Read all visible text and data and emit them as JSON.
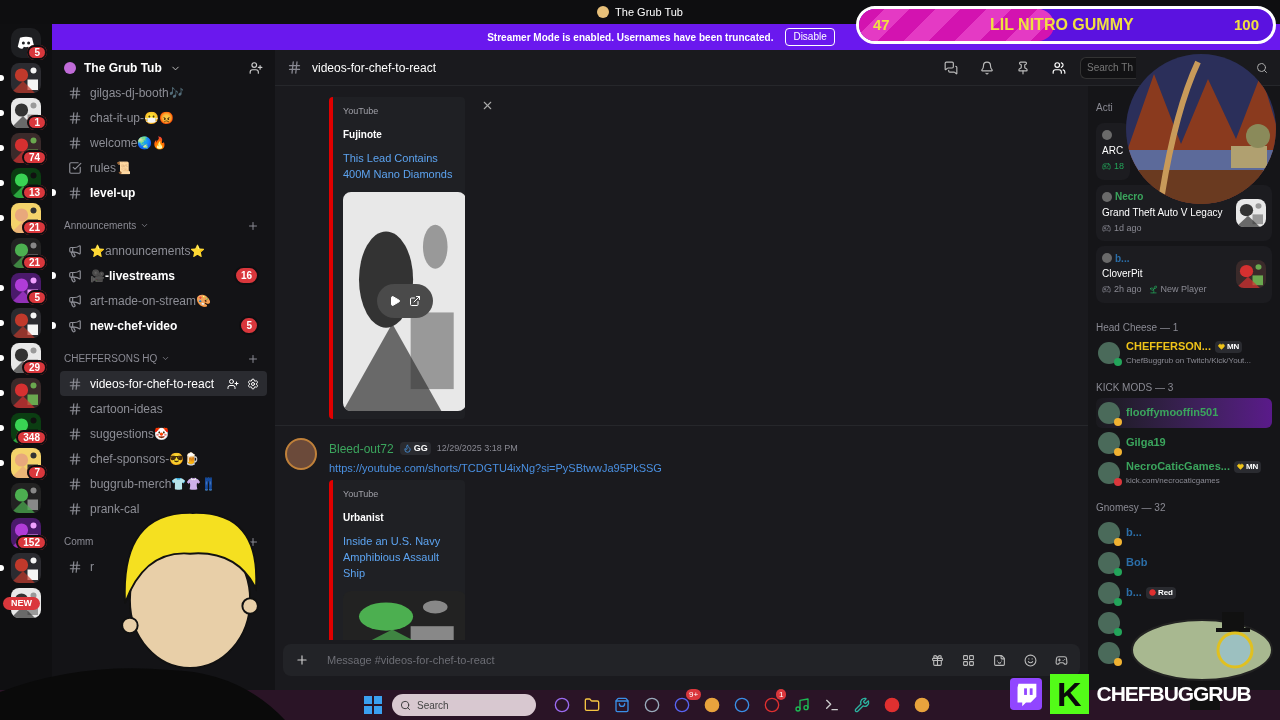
{
  "window": {
    "title": "The Grub Tub"
  },
  "goal_overlay": {
    "current": "47",
    "title": "LIL NITRO GUMMY",
    "target": "100",
    "level": 0.47
  },
  "servers": [
    {
      "kind": "home",
      "badge": "5",
      "unread": false
    },
    {
      "kind": "server",
      "unread": true
    },
    {
      "kind": "server",
      "badge": "1",
      "unread": true
    },
    {
      "kind": "server",
      "badge": "74",
      "unread": true
    },
    {
      "kind": "server",
      "badge": "13",
      "unread": true
    },
    {
      "kind": "server",
      "badge": "21",
      "unread": true
    },
    {
      "kind": "server",
      "badge": "21",
      "unread": false
    },
    {
      "kind": "server",
      "badge": "5",
      "unread": true
    },
    {
      "kind": "server",
      "unread": true
    },
    {
      "kind": "server",
      "badge": "29",
      "unread": true
    },
    {
      "kind": "server",
      "unread": true
    },
    {
      "kind": "server",
      "badge": "348",
      "unread": true
    },
    {
      "kind": "server",
      "badge": "7",
      "unread": true
    },
    {
      "kind": "server",
      "unread": false
    },
    {
      "kind": "server",
      "badge": "152",
      "unread": false
    },
    {
      "kind": "server",
      "unread": true
    },
    {
      "kind": "server",
      "badge": "NEW",
      "unread": false
    }
  ],
  "banner": {
    "text": "Streamer Mode is enabled. Usernames have been truncated.",
    "button": "Disable"
  },
  "server_header": {
    "name": "The Grub Tub"
  },
  "channel_groups": [
    {
      "channels": [
        {
          "name": "gilgas-dj-booth🎶",
          "kind": "text",
          "unread": false,
          "selected": false
        },
        {
          "name": "chat-it-up-😷😡",
          "kind": "text",
          "unread": false,
          "selected": false
        },
        {
          "name": "welcome🌏🔥",
          "kind": "text",
          "unread": false,
          "selected": false
        },
        {
          "name": "rules📜",
          "kind": "rules",
          "unread": false,
          "selected": false
        },
        {
          "name": "level-up",
          "kind": "text",
          "unread": true,
          "selected": false
        }
      ]
    },
    {
      "name": "Announcements",
      "channels": [
        {
          "name": "⭐announcements⭐",
          "kind": "announcement",
          "unread": false,
          "selected": false
        },
        {
          "name": "🎥-livestreams",
          "kind": "announcement",
          "unread": true,
          "selected": false,
          "badge": "16"
        },
        {
          "name": "art-made-on-stream🎨",
          "kind": "announcement",
          "unread": false,
          "selected": false
        },
        {
          "name": "new-chef-video",
          "kind": "announcement",
          "unread": true,
          "selected": false,
          "badge": "5"
        }
      ]
    },
    {
      "name": "CHEFFERSONS HQ",
      "channels": [
        {
          "name": "videos-for-chef-to-react",
          "kind": "text",
          "unread": false,
          "selected": true
        },
        {
          "name": "cartoon-ideas",
          "kind": "text",
          "unread": false,
          "selected": false
        },
        {
          "name": "suggestions🤡",
          "kind": "text",
          "unread": false,
          "selected": false
        },
        {
          "name": "chef-sponsors-😎🍺",
          "kind": "text",
          "unread": false,
          "selected": false
        },
        {
          "name": "buggrub-merch👕👚👖",
          "kind": "text",
          "unread": false,
          "selected": false
        },
        {
          "name": "prank-cal",
          "kind": "text",
          "unread": false,
          "selected": false
        }
      ]
    },
    {
      "name": "Comm",
      "channels": [
        {
          "name": "r",
          "kind": "text",
          "unread": false,
          "selected": false
        }
      ]
    }
  ],
  "chat_header": {
    "channel": "videos-for-chef-to-react",
    "search_placeholder": "Search Th"
  },
  "messages": [
    {
      "embed": {
        "provider": "YouTube",
        "author": "Fujinote",
        "title": "This Lead Contains 400M Nano Diamonds",
        "dismissable": true
      }
    },
    {
      "author": "Bleed-out72",
      "color": "#3ba55d",
      "tag": "GG",
      "timestamp": "12/29/2025 3:18 PM",
      "link": "https://youtube.com/shorts/TCDGTU4ixNg?si=PySBtwwJa95PkSSG",
      "embed": {
        "provider": "YouTube",
        "author": "Urbanist",
        "title": "Inside an U.S. Navy Amphibious Assault Ship",
        "dismissable": false
      }
    }
  ],
  "composer": {
    "placeholder": "Message #videos-for-chef-to-react"
  },
  "member_list": {
    "activity_heading": "Acti",
    "activities": [
      {
        "game": "ARC",
        "time": "18",
        "art": false
      },
      {
        "user": "Necro",
        "color": "#3ba55d",
        "game": "Grand Theft Auto V Legacy",
        "time": "1d ago",
        "art": true
      },
      {
        "user": "b...",
        "color": "#2b6ea8",
        "game": "CloverPit",
        "time": "2h ago",
        "note": "New Player",
        "art": true
      }
    ],
    "sections": [
      {
        "heading": "Head Cheese — 1",
        "members": [
          {
            "name": "CHEFFERSON...",
            "color": "#f0c419",
            "status": {
              "color": "#23a55a"
            },
            "tag": "MN",
            "subtitle": "ChefBuggrub on Twitch/Kick/Yout...",
            "highlighted": false
          }
        ]
      },
      {
        "heading": "KICK MODS — 3",
        "members": [
          {
            "name": "flooffymooffin501",
            "color": "#3ba55d",
            "status": {
              "color": "#f0b232"
            },
            "highlighted": true
          },
          {
            "name": "Gilga19",
            "color": "#3ba55d",
            "status": {
              "color": "#f0b232"
            },
            "highlighted": false
          },
          {
            "name": "NecroCaticGames...",
            "color": "#3ba55d",
            "status": {
              "color": "#da373c"
            },
            "tag": "MN",
            "subtitle": "kick.com/necrocaticgames",
            "highlighted": false
          }
        ]
      },
      {
        "heading": "Gnomesy — 32",
        "members": [
          {
            "name": "b...",
            "color": "#2b6ea8",
            "status": {
              "color": "#f0b232"
            },
            "highlighted": false
          },
          {
            "name": "Bob",
            "color": "#2b6ea8",
            "status": {
              "color": "#23a55a"
            },
            "highlighted": false
          },
          {
            "name": "b...",
            "color": "#2b6ea8",
            "status": {
              "color": "#23a55a"
            },
            "tag": "Red",
            "highlighted": false
          },
          {
            "status": {
              "color": "#23a55a"
            },
            "highlighted": false
          },
          {
            "status": {
              "color": "#f0b232"
            },
            "highlighted": false
          }
        ]
      }
    ]
  },
  "stream_overlay": {
    "logo_mark": "K",
    "logo_text": "CHEFBUGGRUB"
  },
  "taskbar": {
    "search_placeholder": "Search",
    "apps": [
      {
        "kind": "copilot"
      },
      {
        "kind": "folder"
      },
      {
        "kind": "store"
      },
      {
        "kind": "steam"
      },
      {
        "kind": "chat",
        "badge": "9+"
      },
      {
        "kind": "browser"
      },
      {
        "kind": "vpn"
      },
      {
        "kind": "game",
        "badge": "1"
      },
      {
        "kind": "music"
      },
      {
        "kind": "terminal"
      },
      {
        "kind": "tool"
      },
      {
        "kind": "record"
      },
      {
        "kind": "browser"
      }
    ]
  }
}
